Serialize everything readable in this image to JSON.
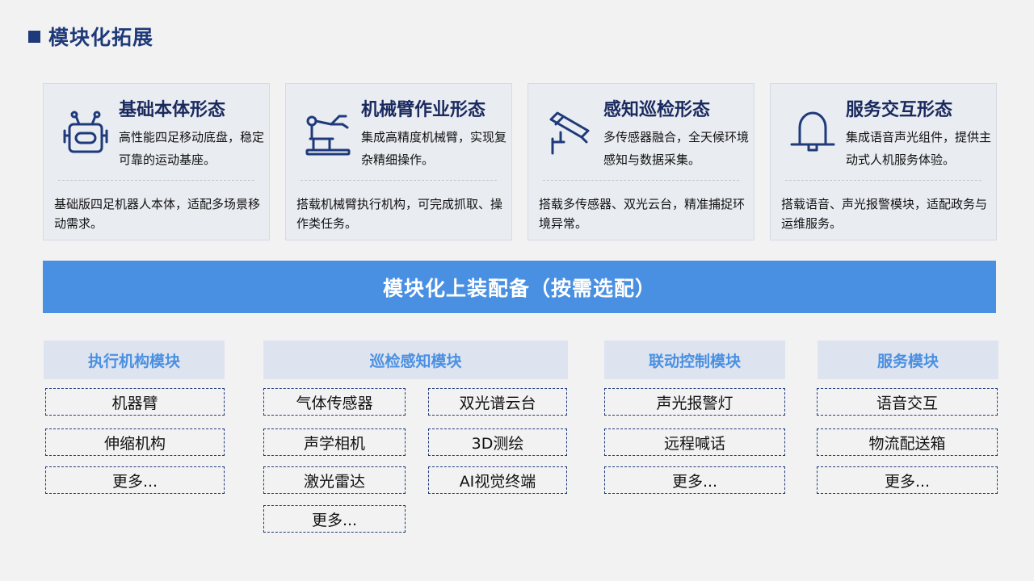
{
  "page": {
    "title": "模块化拓展"
  },
  "cards": [
    {
      "title": "基础本体形态",
      "desc": "高性能四足移动底盘，稳定可靠的运动基座。",
      "foot": "基础版四足机器人本体，适配多场景移动需求。",
      "icon": "robot-head-icon"
    },
    {
      "title": "机械臂作业形态",
      "desc": "集成高精度机械臂，实现复杂精细操作。",
      "foot": "搭载机械臂执行机构，可完成抓取、操作类任务。",
      "icon": "robotic-arm-icon"
    },
    {
      "title": "感知巡检形态",
      "desc": "多传感器融合，全天候环境感知与数据采集。",
      "foot": "搭载多传感器、双光云台，精准捕捉环境异常。",
      "icon": "surveillance-camera-icon"
    },
    {
      "title": "服务交互形态",
      "desc": "集成语音声光组件，提供主动式人机服务体验。",
      "foot": "搭载语音、声光报警模块，适配政务与运维服务。",
      "icon": "bell-icon"
    }
  ],
  "banner": {
    "text": "模块化上装配备（按需选配）"
  },
  "modules": {
    "exec": {
      "title": "执行机构模块",
      "items": [
        "机器臂",
        "伸缩机构",
        "更多..."
      ]
    },
    "sense": {
      "title": "巡检感知模块",
      "left": [
        "气体传感器",
        "声学相机",
        "激光雷达",
        "更多..."
      ],
      "right": [
        "双光谱云台",
        "3D测绘",
        "AI视觉终端"
      ]
    },
    "link": {
      "title": "联动控制模块",
      "items": [
        "声光报警灯",
        "远程喊话",
        "更多..."
      ]
    },
    "serv": {
      "title": "服务模块",
      "items": [
        "语音交互",
        "物流配送箱",
        "更多..."
      ]
    }
  },
  "colors": {
    "navy": "#1f3a7a",
    "accent": "#4a90e2",
    "card_bg": "#e9ecf1",
    "head_bg": "#dde3ef"
  }
}
